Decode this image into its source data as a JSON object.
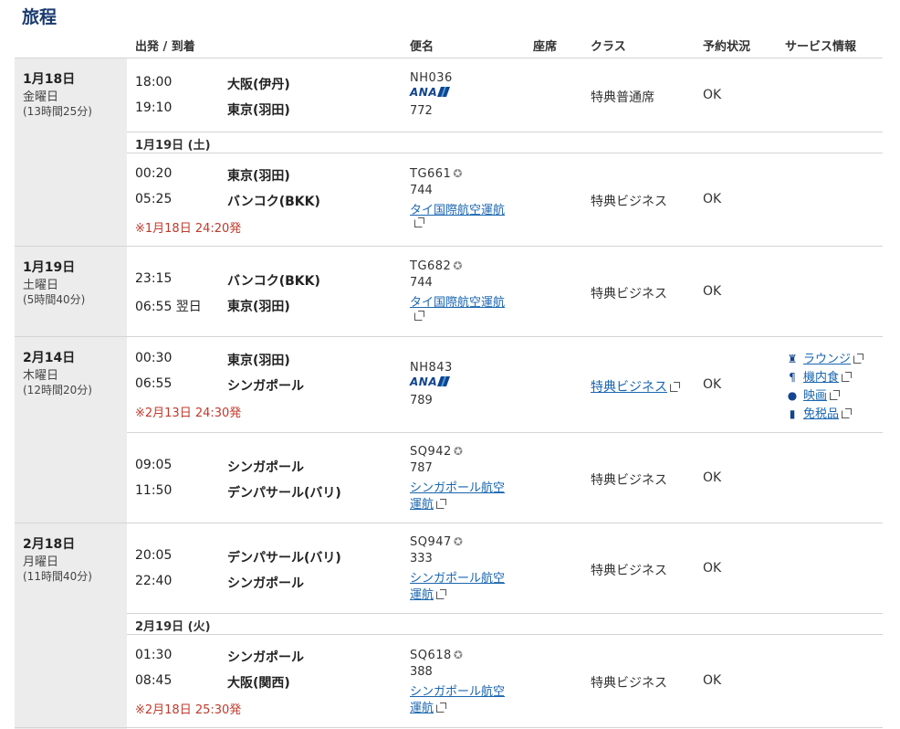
{
  "page_title": "旅程",
  "headers": {
    "depart_arrive": "出発 / 到着",
    "flight": "便名",
    "seat": "座席",
    "class": "クラス",
    "status": "予約状況",
    "service": "サービス情報"
  },
  "days": [
    {
      "date": "1月18日",
      "weekday": "金曜日",
      "duration": "(13時間25分)"
    },
    {
      "date": "1月19日",
      "weekday": "土曜日",
      "duration": "(5時間40分)"
    },
    {
      "date": "2月14日",
      "weekday": "木曜日",
      "duration": "(12時間20分)"
    },
    {
      "date": "2月18日",
      "weekday": "月曜日",
      "duration": "(11時間40分)"
    }
  ],
  "sub_dates": [
    "1月19日 (土)",
    "2月19日 (火)"
  ],
  "segments": [
    {
      "dep_time": "18:00",
      "dep_city": "大阪(伊丹)",
      "arr_time": "19:10",
      "arr_city": "東京(羽田)",
      "flight": "NH036",
      "airline_logo": "ANA",
      "aircraft": "772",
      "class": "特典普通席",
      "status": "OK"
    },
    {
      "dep_time": "00:20",
      "dep_city": "東京(羽田)",
      "arr_time": "05:25",
      "arr_city": "バンコク(BKK)",
      "note": "※1月18日 24:20発",
      "flight": "TG661",
      "aircraft": "744",
      "operated": "タイ国際航空運航",
      "class": "特典ビジネス",
      "status": "OK"
    },
    {
      "dep_time": "23:15",
      "dep_city": "バンコク(BKK)",
      "arr_time": "06:55 翌日",
      "arr_city": "東京(羽田)",
      "flight": "TG682",
      "aircraft": "744",
      "operated": "タイ国際航空運航",
      "class": "特典ビジネス",
      "status": "OK"
    },
    {
      "dep_time": "00:30",
      "dep_city": "東京(羽田)",
      "arr_time": "06:55",
      "arr_city": "シンガポール",
      "note": "※2月13日 24:30発",
      "flight": "NH843",
      "airline_logo": "ANA",
      "aircraft": "789",
      "class": "特典ビジネス",
      "status": "OK"
    },
    {
      "dep_time": "09:05",
      "dep_city": "シンガポール",
      "arr_time": "11:50",
      "arr_city": "デンパサール(バリ)",
      "flight": "SQ942",
      "aircraft": "787",
      "operated_1": "シンガポール航空",
      "operated_2": "運航",
      "class": "特典ビジネス",
      "status": "OK"
    },
    {
      "dep_time": "20:05",
      "dep_city": "デンパサール(バリ)",
      "arr_time": "22:40",
      "arr_city": "シンガポール",
      "flight": "SQ947",
      "aircraft": "333",
      "operated_1": "シンガポール航空",
      "operated_2": "運航",
      "class": "特典ビジネス",
      "status": "OK"
    },
    {
      "dep_time": "01:30",
      "dep_city": "シンガポール",
      "arr_time": "08:45",
      "arr_city": "大阪(関西)",
      "note": "※2月18日 25:30発",
      "flight": "SQ618",
      "aircraft": "388",
      "operated_1": "シンガポール航空",
      "operated_2": "運航",
      "class": "特典ビジネス",
      "status": "OK"
    }
  ],
  "services": {
    "lounge": "ラウンジ",
    "meal": "機内食",
    "movie": "映画",
    "duty_free": "免税品"
  },
  "colors": {
    "accent": "#1a3a6e",
    "link": "#1a66b0",
    "note": "#c0392b",
    "date_col_bg": "#ececec"
  }
}
